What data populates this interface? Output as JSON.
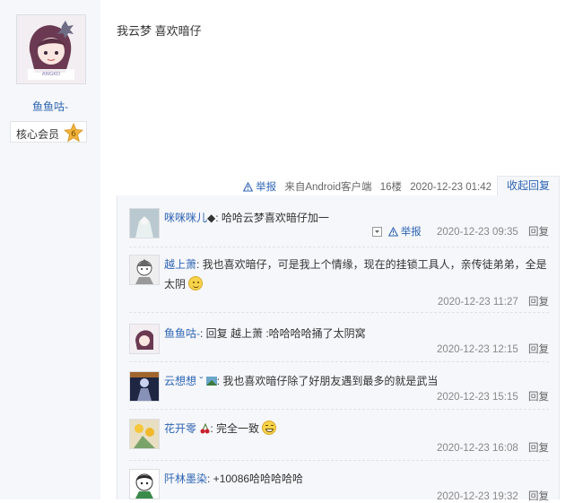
{
  "post": {
    "author": "鱼鱼咕-",
    "badge_label": "核心会员",
    "badge_level": "6",
    "text": "我云梦 喜欢暗仔",
    "report": "举报",
    "source": "来自Android客户端",
    "floor": "16楼",
    "time": "2020-12-23 01:42",
    "fold_label": "收起回复"
  },
  "replies": [
    {
      "name": "咪咪咪儿",
      "suffix": "◆",
      "text": ": 哈哈云梦喜欢暗仔加一",
      "report": "举报",
      "time": "2020-12-23 09:35",
      "reply": "回复"
    },
    {
      "name": "越上萧",
      "text": ": 我也喜欢暗仔，可是我上个情缘，现在的挂锁工具人，亲传徒弟弟，全是太阴",
      "time": "2020-12-23 11:27",
      "reply": "回复"
    },
    {
      "name": "鱼鱼咕-",
      "text": ": 回复 越上萧 :哈哈哈哈捅了太阴窝",
      "time": "2020-12-23 12:15",
      "reply": "回复"
    },
    {
      "name": "云想想",
      "text": ": 我也喜欢暗仔除了好朋友遇到最多的就是武当",
      "time": "2020-12-23 15:15",
      "reply": "回复"
    },
    {
      "name": "花开零",
      "text": ": 完全一致",
      "time": "2020-12-23 16:08",
      "reply": "回复"
    },
    {
      "name": "阡林墨染",
      "text": ": +10086哈哈哈哈哈",
      "time": "2020-12-23 19:32",
      "reply": "回复"
    }
  ],
  "colors": {
    "link": "#2d64b3",
    "panel": "#f6f7fa",
    "badge_star": "#f2b33b"
  },
  "icons": [
    "report-icon",
    "level-star-icon",
    "dropdown-icon",
    "smile-emoji-icon",
    "grin-emoji-icon",
    "cherry-icon",
    "flag-icon"
  ]
}
